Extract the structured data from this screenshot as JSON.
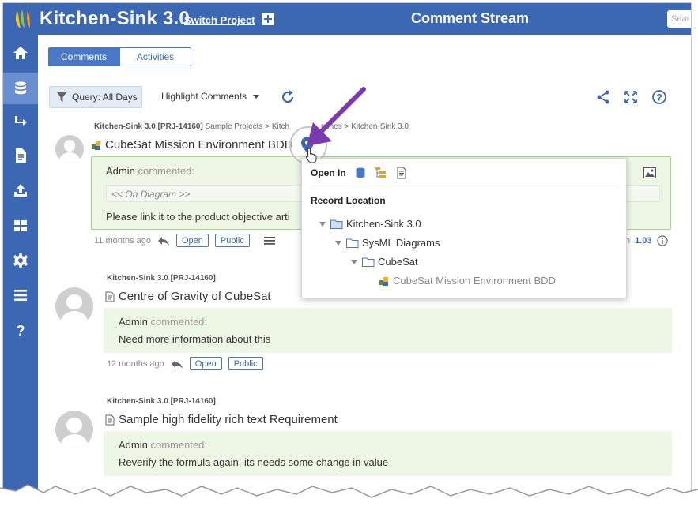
{
  "header": {
    "project_title": "Kitchen-Sink 3.0",
    "switch_project": "Switch Project",
    "page_title": "Comment Stream",
    "search_placeholder": "Sear"
  },
  "tabs": [
    {
      "label": "Comments",
      "active": true
    },
    {
      "label": "Activities",
      "active": false
    }
  ],
  "toolbar": {
    "query_label": "Query: All Days",
    "highlight_label": "Highlight Comments"
  },
  "comments": [
    {
      "breadcrumb_project": "Kitchen-Sink 3.0 [PRJ-14160]",
      "breadcrumb_path": "Sample Projects > Kitch",
      "breadcrumb_tail": "nches > Kitchen-Sink 3.0",
      "title": "CubeSat Mission Environment BDD",
      "author": "Admin",
      "action": "commented:",
      "diagram_ref": "<< On Diagram >>",
      "text": "Please link it to the product objective arti",
      "time": "11 months ago",
      "status": "Open",
      "visibility": "Public",
      "version_suffix": "n",
      "version": "1.03"
    },
    {
      "breadcrumb_project": "Kitchen-Sink 3.0 [PRJ-14160]",
      "title": "Centre of Gravity of CubeSat",
      "author": "Admin",
      "action": "commented:",
      "text": "Need more information about this",
      "time": "12 months ago",
      "status": "Open",
      "visibility": "Public"
    },
    {
      "breadcrumb_project": "Kitchen-Sink 3.0 [PRJ-14160]",
      "title": "Sample high fidelity rich text Requirement",
      "author": "Admin",
      "action": "commented:",
      "text": "Reverify the formula again, its needs some change in value"
    }
  ],
  "popup": {
    "open_in": "Open In",
    "record_location": "Record Location",
    "tree": [
      {
        "label": "Kitchen-Sink 3.0",
        "level": 0
      },
      {
        "label": "SysML Diagrams",
        "level": 1
      },
      {
        "label": "CubeSat",
        "level": 2
      },
      {
        "label": "CubeSat Mission Environment BDD",
        "level": 3
      }
    ]
  },
  "colors": {
    "brand": "#3c67b3",
    "comment_bg": "#eef7e6",
    "highlight_border": "#9fdc7f",
    "annotation_arrow": "#7b3ab0"
  }
}
